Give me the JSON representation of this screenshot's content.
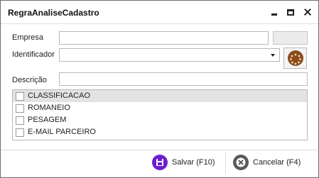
{
  "window": {
    "title": "RegraAnaliseCadastro"
  },
  "form": {
    "empresa_label": "Empresa",
    "empresa_value": "",
    "identificador_label": "Identificador",
    "identificador_value": "",
    "descricao_label": "Descrição",
    "descricao_value": ""
  },
  "options": [
    {
      "label": "CLASSIFICACAO",
      "checked": false,
      "selected": true
    },
    {
      "label": "ROMANEIO",
      "checked": false,
      "selected": false
    },
    {
      "label": "PESAGEM",
      "checked": false,
      "selected": false
    },
    {
      "label": "E-MAIL PARCEIRO",
      "checked": false,
      "selected": false
    }
  ],
  "buttons": {
    "save_label": "Salvar (F10)",
    "cancel_label": "Cancelar (F4)"
  },
  "colors": {
    "save_icon": "#6a1fd0",
    "cancel_icon": "#5a5a5a",
    "search_icon": "#8a4b1e"
  },
  "icons": {
    "search": "cookie-search-icon",
    "save": "floppy-disk-icon",
    "cancel": "x-circle-icon"
  }
}
